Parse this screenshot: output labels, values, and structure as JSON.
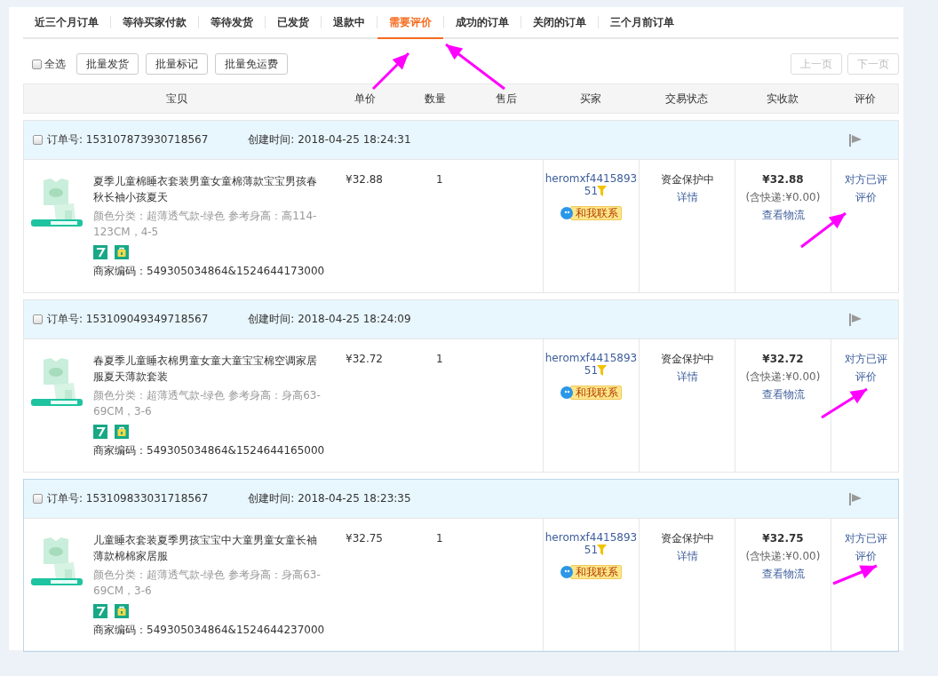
{
  "tabs": [
    {
      "label": "近三个月订单",
      "selected": false
    },
    {
      "label": "等待买家付款",
      "selected": false
    },
    {
      "label": "等待发货",
      "selected": false
    },
    {
      "label": "已发货",
      "selected": false
    },
    {
      "label": "退款中",
      "selected": false
    },
    {
      "label": "需要评价",
      "selected": true
    },
    {
      "label": "成功的订单",
      "selected": false
    },
    {
      "label": "关闭的订单",
      "selected": false
    },
    {
      "label": "三个月前订单",
      "selected": false
    }
  ],
  "toolbar": {
    "select_all": {
      "label": "全选",
      "checked": false
    },
    "buttons": [
      "批量发货",
      "批量标记",
      "批量免运费"
    ],
    "pager": [
      {
        "label": "上一页",
        "disabled": true
      },
      {
        "label": "下一页",
        "disabled": true
      }
    ]
  },
  "columns": [
    "宝贝",
    "单价",
    "数量",
    "售后",
    "买家",
    "交易状态",
    "实收款",
    "评价"
  ],
  "orders": [
    {
      "checked": false,
      "hovered": false,
      "order_no": "订单号: 153107873930718567",
      "created": "创建时间: 2018-04-25 18:24:31",
      "title": "夏季儿童棉睡衣套装男童女童棉薄款宝宝男孩春秋长袖小孩夏天",
      "sku": "颜色分类：超薄透气款-绿色  参考身高：高114-123CM，4-5",
      "merchant_code": "商家编码：549305034864&1524644173000",
      "price": "¥32.88",
      "qty": "1",
      "buyer": "heromxf441589351",
      "contact": "和我联系",
      "status": "资金保护中",
      "detail": "详情",
      "total": "¥32.88",
      "shipping": "(含快递:¥0.00)",
      "logistics": "查看物流",
      "review_status": "对方已评",
      "review_link": "评价"
    },
    {
      "checked": false,
      "hovered": false,
      "order_no": "订单号: 153109049349718567",
      "created": "创建时间: 2018-04-25 18:24:09",
      "title": "春夏季儿童睡衣棉男童女童大童宝宝棉空调家居服夏天薄款套装",
      "sku": "颜色分类：超薄透气款-绿色  参考身高：身高63-69CM，3-6",
      "merchant_code": "商家编码：549305034864&1524644165000",
      "price": "¥32.72",
      "qty": "1",
      "buyer": "heromxf441589351",
      "contact": "和我联系",
      "status": "资金保护中",
      "detail": "详情",
      "total": "¥32.72",
      "shipping": "(含快递:¥0.00)",
      "logistics": "查看物流",
      "review_status": "对方已评",
      "review_link": "评价"
    },
    {
      "checked": false,
      "hovered": true,
      "order_no": "订单号: 153109833031718567",
      "created": "创建时间: 2018-04-25 18:23:35",
      "title": "儿童睡衣套装夏季男孩宝宝中大童男童女童长袖薄款棉棉家居服",
      "sku": "颜色分类：超薄透气款-绿色  参考身高：身高63-69CM，3-6",
      "merchant_code": "商家编码：549305034864&1524644237000",
      "price": "¥32.75",
      "qty": "1",
      "buyer": "heromxf441589351",
      "contact": "和我联系",
      "status": "资金保护中",
      "detail": "详情",
      "total": "¥32.75",
      "shipping": "(含快递:¥0.00)",
      "logistics": "查看物流",
      "review_status": "对方已评",
      "review_link": "评价"
    }
  ]
}
